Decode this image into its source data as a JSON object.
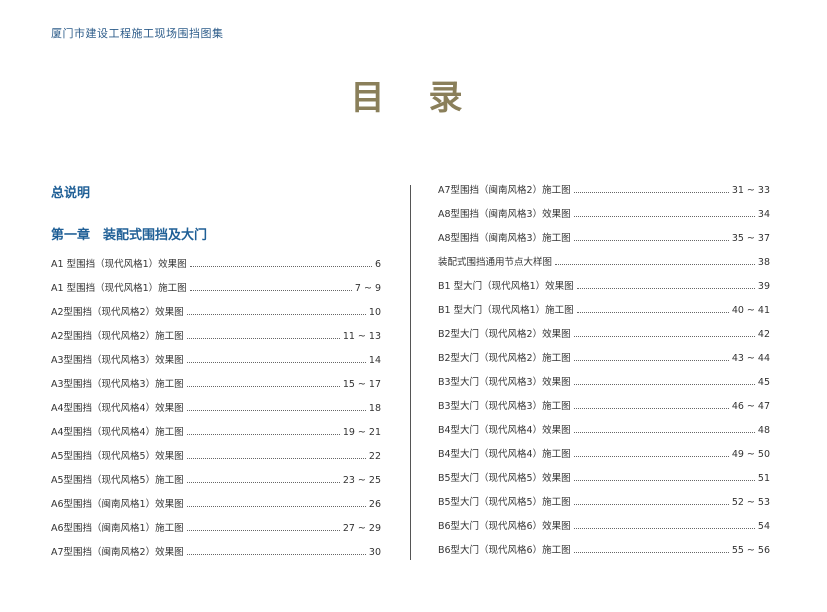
{
  "header": {
    "title": "厦门市建设工程施工现场围挡图集"
  },
  "page_title": "目录",
  "sections": {
    "general": "总说明",
    "chapter1": "第一章　装配式围挡及大门"
  },
  "toc_left": [
    {
      "label": "A1 型围挡（现代风格1）效果图",
      "page": "6"
    },
    {
      "label": "A1 型围挡（现代风格1）施工图",
      "page": "7 ~ 9"
    },
    {
      "label": "A2型围挡（现代风格2）效果图",
      "page": "10"
    },
    {
      "label": "A2型围挡（现代风格2）施工图",
      "page": "11 ~ 13"
    },
    {
      "label": "A3型围挡（现代风格3）效果图",
      "page": "14"
    },
    {
      "label": "A3型围挡（现代风格3）施工图",
      "page": "15 ~ 17"
    },
    {
      "label": "A4型围挡（现代风格4）效果图",
      "page": "18"
    },
    {
      "label": "A4型围挡（现代风格4）施工图",
      "page": "19 ~ 21"
    },
    {
      "label": "A5型围挡（现代风格5）效果图",
      "page": "22"
    },
    {
      "label": "A5型围挡（现代风格5）施工图",
      "page": "23 ~ 25"
    },
    {
      "label": "A6型围挡（闽南风格1）效果图",
      "page": "26"
    },
    {
      "label": "A6型围挡（闽南风格1）施工图",
      "page": "27 ~ 29"
    },
    {
      "label": "A7型围挡（闽南风格2）效果图",
      "page": "30"
    }
  ],
  "toc_right": [
    {
      "label": "A7型围挡（闽南风格2）施工图",
      "page": "31 ~ 33"
    },
    {
      "label": "A8型围挡（闽南风格3）效果图",
      "page": "34"
    },
    {
      "label": "A8型围挡（闽南风格3）施工图",
      "page": "35 ~ 37"
    },
    {
      "label": "装配式围挡通用节点大样图",
      "page": "38"
    },
    {
      "label": "B1 型大门（现代风格1）效果图",
      "page": "39"
    },
    {
      "label": "B1 型大门（现代风格1）施工图",
      "page": "40 ~ 41"
    },
    {
      "label": "B2型大门（现代风格2）效果图",
      "page": "42"
    },
    {
      "label": "B2型大门（现代风格2）施工图",
      "page": "43 ~ 44"
    },
    {
      "label": "B3型大门（现代风格3）效果图",
      "page": "45"
    },
    {
      "label": "B3型大门（现代风格3）施工图",
      "page": "46 ~ 47"
    },
    {
      "label": "B4型大门（现代风格4）效果图",
      "page": "48"
    },
    {
      "label": "B4型大门（现代风格4）施工图",
      "page": "49 ~ 50"
    },
    {
      "label": "B5型大门（现代风格5）效果图",
      "page": "51"
    },
    {
      "label": "B5型大门（现代风格5）施工图",
      "page": "52 ~ 53"
    },
    {
      "label": "B6型大门（现代风格6）效果图",
      "page": "54"
    },
    {
      "label": "B6型大门（现代风格6）施工图",
      "page": "55 ~ 56"
    }
  ]
}
